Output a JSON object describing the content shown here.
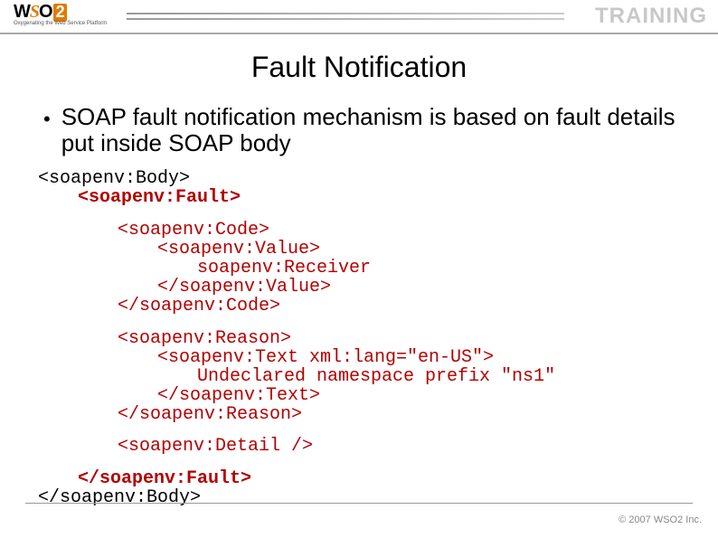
{
  "header": {
    "logo_text_parts": {
      "w": "W",
      "s": "S",
      "o": "O",
      "two": "2"
    },
    "logo_tagline": "Oxygenating the Web Service Platform",
    "training_label": "TRAINING"
  },
  "slide": {
    "title": "Fault Notification",
    "bullet": "SOAP fault notification mechanism is based on fault details put inside SOAP body",
    "code": {
      "body_open": "<soapenv:Body>",
      "fault_open": "<soapenv:Fault>",
      "code_open": "<soapenv:Code>",
      "value_open": "<soapenv:Value>",
      "value_text": "soapenv:Receiver",
      "value_close": "</soapenv:Value>",
      "code_close": "</soapenv:Code>",
      "reason_open": "<soapenv:Reason>",
      "text_open": "<soapenv:Text xml:lang=\"en-US\">",
      "text_text": "Undeclared namespace prefix \"ns1\"",
      "text_close": "</soapenv:Text>",
      "reason_close": "</soapenv:Reason>",
      "detail": "<soapenv:Detail />",
      "fault_close": "</soapenv:Fault>",
      "body_close": "</soapenv:Body>"
    }
  },
  "footer": {
    "copyright": "© 2007 WSO2 Inc."
  }
}
